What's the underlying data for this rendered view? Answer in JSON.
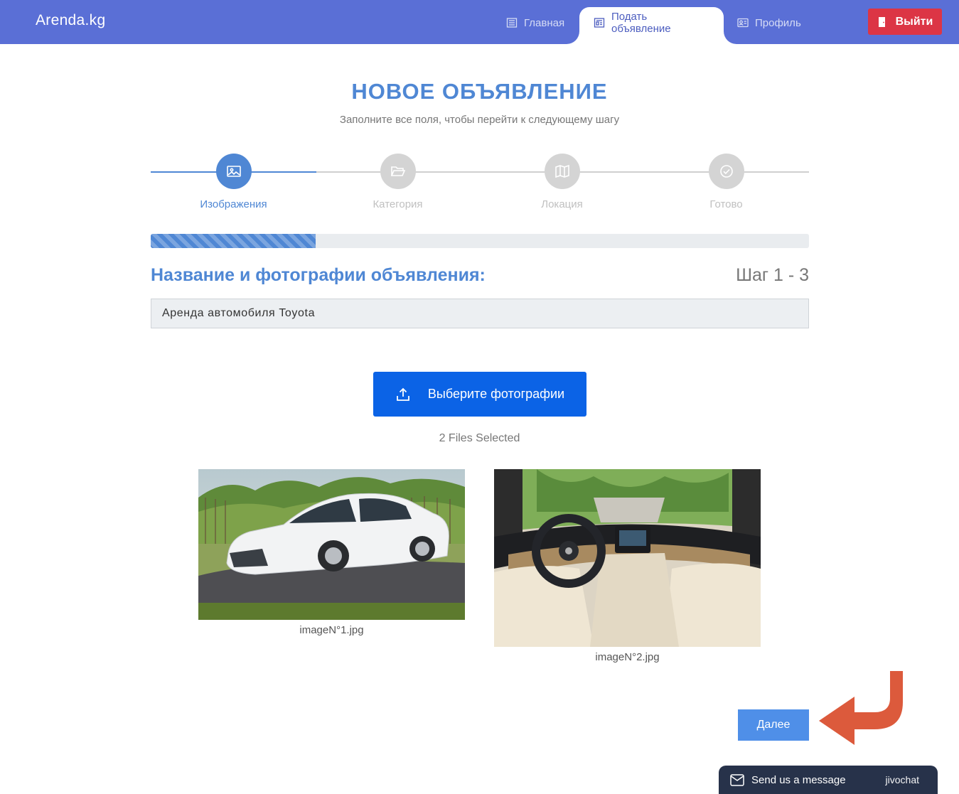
{
  "navbar": {
    "brand": "Arenda.kg",
    "items": [
      {
        "label": "Главная",
        "icon": "news-icon"
      },
      {
        "label": "Подать объявление",
        "icon": "news-icon",
        "active": true
      },
      {
        "label": "Профиль",
        "icon": "id-card-icon"
      }
    ],
    "logout_label": "Выйти",
    "logout_icon": "door-icon"
  },
  "header": {
    "title": "НОВОЕ ОБЪЯВЛЕНИЕ",
    "subtitle": "Заполните все поля, чтобы перейти к следующему шагу"
  },
  "steps": [
    {
      "label": "Изображения",
      "icon": "image-icon",
      "active": true
    },
    {
      "label": "Категория",
      "icon": "folder-open-icon",
      "active": false
    },
    {
      "label": "Локация",
      "icon": "map-icon",
      "active": false
    },
    {
      "label": "Готово",
      "icon": "check-circle-icon",
      "active": false
    }
  ],
  "progress": {
    "fraction": 0.25
  },
  "form": {
    "section_title": "Название и фотографии объявления:",
    "step_counter": "Шаг 1 - 3",
    "title_value": "Аренда автомобиля Toyota",
    "upload_label": "Выберите фотографии",
    "upload_icon": "upload-icon",
    "files_selected": "2 Files Selected"
  },
  "images": [
    {
      "caption": "imageN°1.jpg"
    },
    {
      "caption": "imageN°2.jpg"
    }
  ],
  "next_label": "Далее",
  "chat": {
    "label": "Send us a message",
    "brand": "jivochat"
  },
  "colors": {
    "navbar": "#5a6fd6",
    "accent": "#4f87d4",
    "upload_button": "#0b63e6",
    "logout_button": "#dc3545",
    "next_button": "#4f8fe8",
    "hint_arrow": "#dc5a3c",
    "chat": "#27324a"
  }
}
